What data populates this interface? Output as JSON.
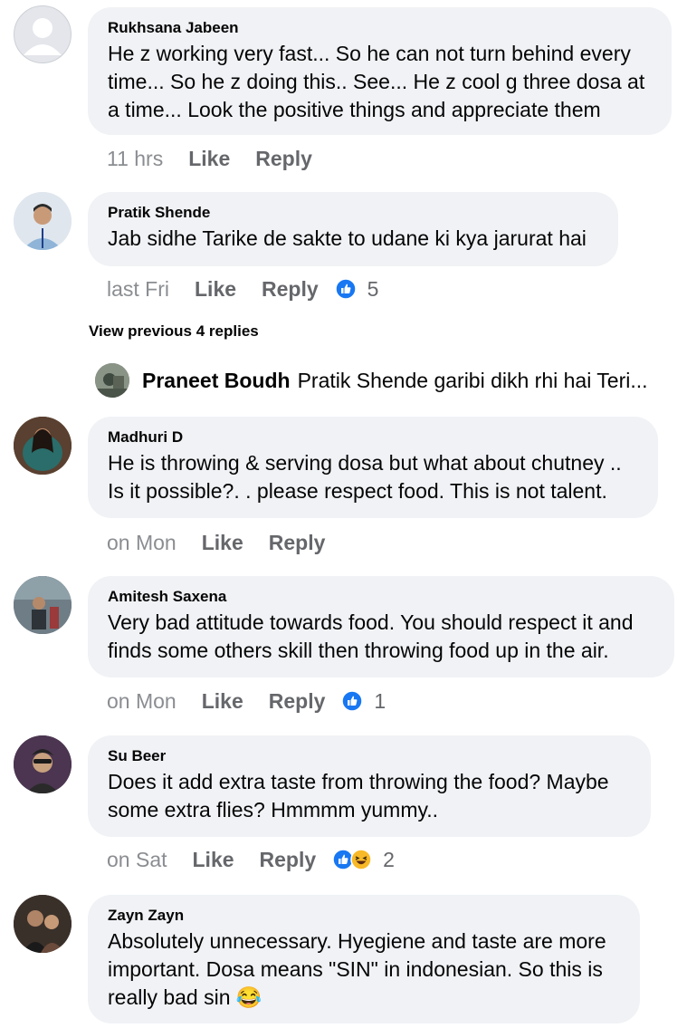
{
  "comments": [
    {
      "name": "Rukhsana Jabeen",
      "lines": [
        "He z working very fast... So he can not turn behind every",
        "time... So he z doing this.. See... He z cool g three dosa at",
        "a time... Look the positive things  and appreciate them"
      ],
      "time": "11 hrs",
      "like": "Like",
      "reply": "Reply",
      "reaction_count": ""
    },
    {
      "name": "Pratik Shende",
      "lines": [
        "Jab sidhe Tarike de sakte to udane ki kya jarurat hai"
      ],
      "time": "last Fri",
      "like": "Like",
      "reply": "Reply",
      "reaction_count": "5"
    },
    {
      "name": "Madhuri D",
      "lines": [
        "He is throwing & serving dosa but what about chutney ..",
        "Is it possible?. .  please respect food.  This is not talent."
      ],
      "time": "on Mon",
      "like": "Like",
      "reply": "Reply",
      "reaction_count": ""
    },
    {
      "name": "Amitesh Saxena",
      "lines": [
        "Very bad attitude towards food. You should respect it and",
        "finds some others skill then throwing food up in the air."
      ],
      "time": "on Mon",
      "like": "Like",
      "reply": "Reply",
      "reaction_count": "1"
    },
    {
      "name": "Su Beer",
      "lines": [
        "Does it add extra taste from throwing the  food? Maybe",
        "some extra flies? Hmmmm yummy.."
      ],
      "time": "on Sat",
      "like": "Like",
      "reply": "Reply",
      "reaction_count": "2"
    },
    {
      "name": "Zayn Zayn",
      "lines": [
        "Absolutely unnecessary. Hyegiene and taste are more",
        "important. Dosa means \"SIN\" in indonesian. So this is",
        "really bad sin 😂"
      ],
      "time": "",
      "like": "",
      "reply": "",
      "reaction_count": ""
    }
  ],
  "view_previous": "View previous 4 replies",
  "reply_preview": {
    "name": "Praneet Boudh",
    "text": "Pratik Shende garibi dikh rhi hai Teri..."
  },
  "icons": {
    "like_reaction": "thumbs-up-icon",
    "haha_reaction": "laughing-emoji-icon",
    "avatar_placeholder": "default-avatar-icon"
  },
  "colors": {
    "bubble": "#f0f2f5",
    "like_blue": "#1877f2",
    "meta_gray": "#65676b"
  }
}
